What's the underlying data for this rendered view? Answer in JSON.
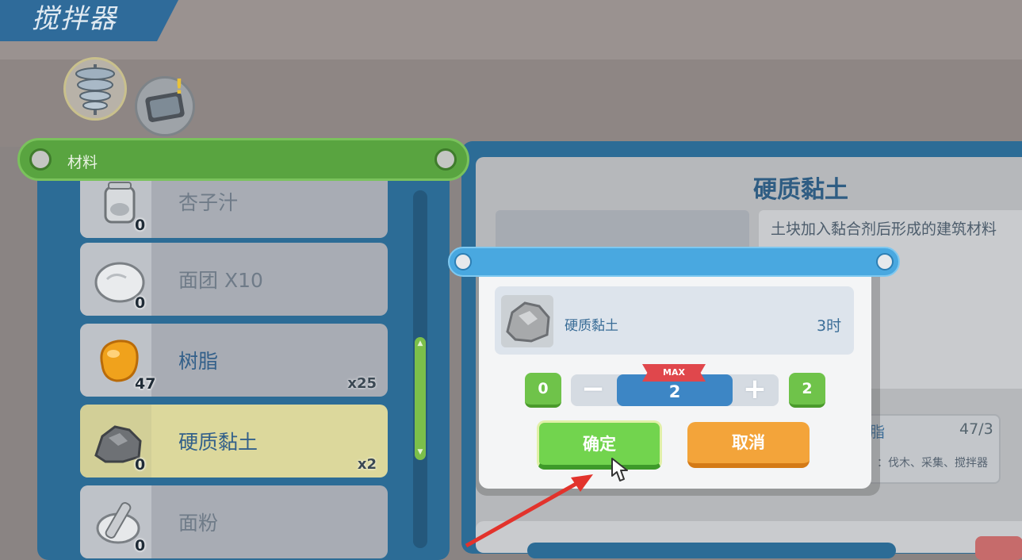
{
  "window": {
    "title": "搅拌器"
  },
  "category_tabs": [
    {
      "icon": "mixer-auger-icon"
    },
    {
      "icon": "tablet-icon",
      "alert": "!"
    }
  ],
  "list": {
    "header": "材料",
    "items": [
      {
        "name": "杏子汁",
        "owned": "0",
        "amount": ""
      },
      {
        "name": "面团 X10",
        "owned": "0",
        "amount": ""
      },
      {
        "name": "树脂",
        "owned": "47",
        "amount": "x25"
      },
      {
        "name": "硬质黏土",
        "owned": "0",
        "amount": "x2"
      },
      {
        "name": "面粉",
        "owned": "0",
        "amount": ""
      }
    ],
    "selected_index": 3
  },
  "detail": {
    "title": "硬质黏土",
    "description": "土块加入黏合剂后形成的建筑材料",
    "requirement": {
      "name": "脂",
      "count": "47/3",
      "source": "：伐木、采集、搅拌器"
    }
  },
  "dialog": {
    "item_name": "硬质黏土",
    "time": "3时",
    "min": "0",
    "max": "2",
    "max_label": "MAX",
    "value": "2",
    "minus": "−",
    "plus": "+",
    "confirm": "确定",
    "cancel": "取消"
  },
  "colors": {
    "header_green": "#59a440",
    "panel_blue": "#2c6c96",
    "dialog_bar": "#49a8e0",
    "confirm_green": "#72d44e",
    "cancel_orange": "#f3a43a",
    "max_red": "#e0474c"
  }
}
